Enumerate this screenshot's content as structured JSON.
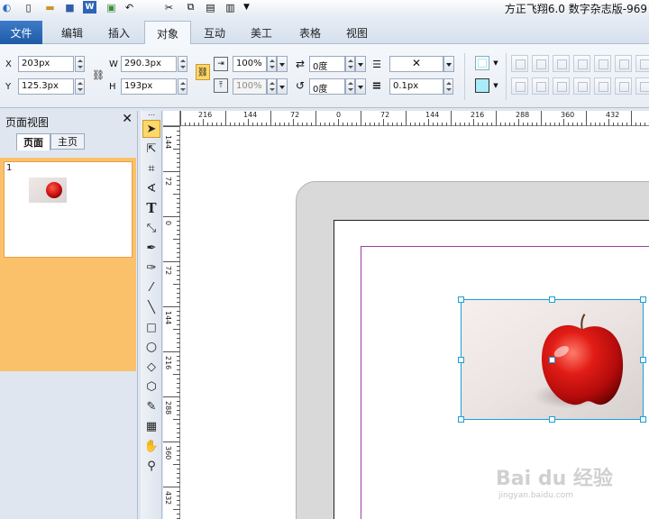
{
  "app": {
    "title": "方正飞翔6.0 数字杂志版-969"
  },
  "menu": {
    "file": "文件",
    "tabs": [
      "编辑",
      "插入",
      "对象",
      "互动",
      "美工",
      "表格",
      "视图"
    ],
    "active_tab": "对象"
  },
  "properties": {
    "x_label": "X",
    "x_value": "203px",
    "y_label": "Y",
    "y_value": "125.3px",
    "w_label": "W",
    "w_value": "290.3px",
    "h_label": "H",
    "h_value": "193px",
    "scale_x": "100%",
    "scale_y": "100%",
    "rotation": "0度",
    "skew": "0度",
    "stroke_style": "✕",
    "stroke_width": "0.1px"
  },
  "panel": {
    "title": "页面视图",
    "close": "✕",
    "tabs": [
      "页面",
      "主页"
    ],
    "page_number": "1"
  },
  "ruler": {
    "h_ticks": [
      "216",
      "144",
      "72",
      "0",
      "72",
      "144",
      "216",
      "288",
      "360",
      "432"
    ],
    "v_ticks": [
      "144",
      "72",
      "0",
      "72",
      "144",
      "216",
      "288",
      "360",
      "432"
    ]
  },
  "watermark": {
    "text": "Bai du 经验",
    "sub": "jingyan.baidu.com"
  },
  "colors": {
    "accent": "#1f5aa6",
    "selection": "#1aa0d8",
    "margin_guide": "#9b3fa6",
    "thumb_highlight": "#fbc16a",
    "fill_swatch": "#a9ecf7"
  }
}
